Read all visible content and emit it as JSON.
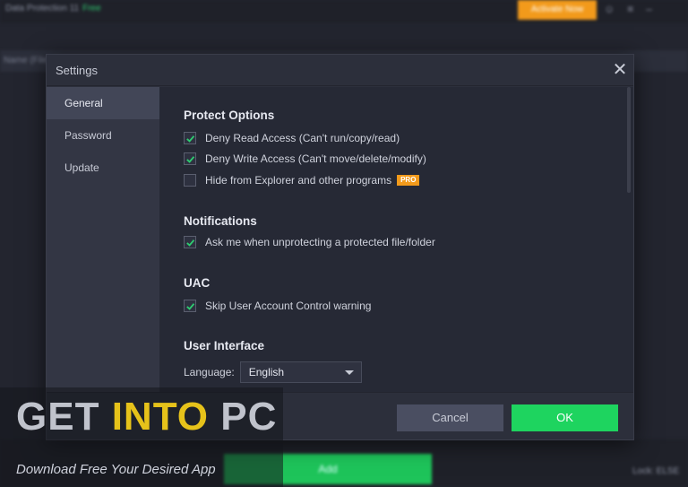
{
  "background_app": {
    "title": "Data Protection 11",
    "title_badge": "Free",
    "upgrade_label": "Activate Now",
    "top_icons": [
      "account-icon",
      "menu-icon",
      "minimize-icon"
    ],
    "header_text": "Name (File)",
    "add_label": "Add",
    "status_text": "Lock: ELSE"
  },
  "dialog": {
    "title": "Settings",
    "close_glyph": "✕",
    "sidebar": [
      {
        "label": "General",
        "active": true
      },
      {
        "label": "Password",
        "active": false
      },
      {
        "label": "Update",
        "active": false
      }
    ],
    "sections": {
      "protect": {
        "title": "Protect Options",
        "options": [
          {
            "label": "Deny Read Access (Can't run/copy/read)",
            "checked": true
          },
          {
            "label": "Deny Write Access (Can't move/delete/modify)",
            "checked": true
          },
          {
            "label": "Hide from Explorer and other programs",
            "checked": false,
            "badge": "PRO"
          }
        ]
      },
      "notifications": {
        "title": "Notifications",
        "options": [
          {
            "label": "Ask me when unprotecting a protected file/folder",
            "checked": true
          }
        ]
      },
      "uac": {
        "title": "UAC",
        "options": [
          {
            "label": "Skip User Account Control warning",
            "checked": true
          }
        ]
      },
      "ui": {
        "title": "User Interface",
        "language_label": "Language:",
        "language_value": "English"
      }
    },
    "buttons": {
      "cancel": "Cancel",
      "ok": "OK"
    }
  },
  "watermark": {
    "logo_part1": "GET ",
    "logo_part2": "INTO",
    "logo_part3": " PC",
    "tagline": "Download Free Your Desired App"
  },
  "colors": {
    "accent_green": "#1ed45f",
    "pro_badge": "#f29a1b",
    "check_green": "#2ecc71",
    "dialog_bg": "#2c2f3b"
  }
}
